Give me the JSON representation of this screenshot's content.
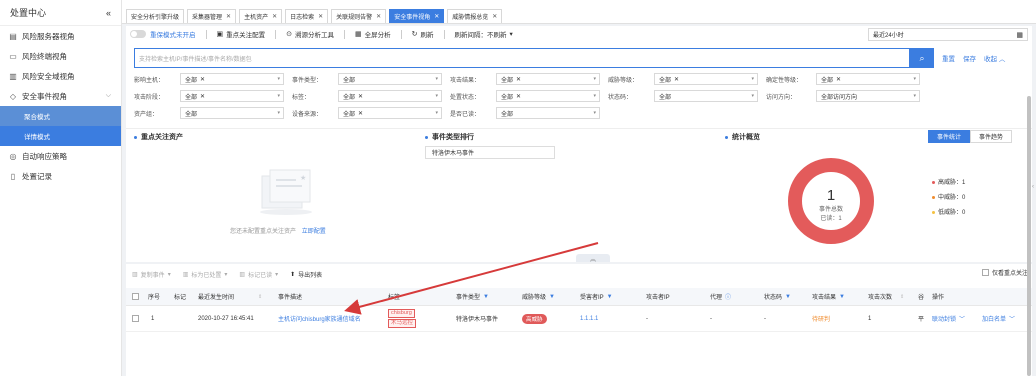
{
  "sidebar": {
    "title": "处置中心",
    "collapse_icon": "«",
    "items": [
      {
        "label": "风险服务器视角",
        "icon": "server-icon"
      },
      {
        "label": "风险终端视角",
        "icon": "monitor-icon"
      },
      {
        "label": "风险安全域视角",
        "icon": "domain-icon"
      },
      {
        "label": "安全事件视角",
        "icon": "shield-icon"
      },
      {
        "label": "自动响应策略",
        "icon": "location-icon"
      },
      {
        "label": "处置记录",
        "icon": "record-icon"
      }
    ],
    "subitems": [
      {
        "label": "聚合模式"
      },
      {
        "label": "详情模式"
      }
    ]
  },
  "tabs": [
    {
      "label": "安全分析引擎升级",
      "closable": false
    },
    {
      "label": "采集器管理",
      "closable": true
    },
    {
      "label": "主机资产",
      "closable": true
    },
    {
      "label": "日志检索",
      "closable": true
    },
    {
      "label": "关联规则告警",
      "closable": true
    },
    {
      "label": "安全事件视角",
      "closable": true,
      "active": true
    },
    {
      "label": "威胁情报总览",
      "closable": true
    }
  ],
  "toolbar": {
    "key_mode": "重保模式未开启",
    "key_config": "重点关注配置",
    "trace_tool": "溯源分析工具",
    "global_analysis": "全屏分析",
    "refresh": "刷新",
    "refresh_interval_label": "刷新间隔：",
    "refresh_interval_value": "不刷新",
    "time_range": "最近24小时"
  },
  "search": {
    "placeholder": "支持检索主机IP/事件描述/事件名称/数据包",
    "reset": "重置",
    "save": "保存",
    "collapse": "收起"
  },
  "filters": {
    "row1": [
      {
        "label": "影响主机：",
        "value": "全部"
      },
      {
        "label": "事件类型：",
        "value": "全部"
      },
      {
        "label": "攻击结果：",
        "value": "全部"
      },
      {
        "label": "威胁等级：",
        "value": "全部"
      },
      {
        "label": "确定性等级：",
        "value": "全部"
      }
    ],
    "row2": [
      {
        "label": "攻击阶段：",
        "value": "全部"
      },
      {
        "label": "标签：",
        "value": "全部"
      },
      {
        "label": "处置状态：",
        "value": "全部"
      },
      {
        "label": "状态码：",
        "value": "全部"
      },
      {
        "label": "访问方向：",
        "value": "全部访问方向"
      }
    ],
    "row3": [
      {
        "label": "资产组：",
        "value": "全部"
      },
      {
        "label": "设备来源：",
        "value": "全部"
      },
      {
        "label": "是否已读：",
        "value": "全部"
      }
    ]
  },
  "sections": {
    "key_assets": "重点关注资产",
    "event_rank": "事件类型排行",
    "stats": "统计概览",
    "empty_text": "您还未配置重点关注资产",
    "empty_link": "立即配置",
    "rank_item": "特洛伊木马事件",
    "stat_btn_events": "事件统计",
    "stat_btn_trend": "事件趋势"
  },
  "chart_data": {
    "type": "pie",
    "center_value": "1",
    "center_label": "事件总数",
    "center_sub": "已读：1",
    "slices": [
      {
        "name": "高威胁",
        "value": 1,
        "color": "#e35b5b"
      },
      {
        "name": "中威胁",
        "value": 0,
        "color": "#f08c2e"
      },
      {
        "name": "低威胁",
        "value": 0,
        "color": "#f5c242"
      }
    ],
    "legend_labels": [
      "高威胁：1",
      "中威胁：0",
      "低威胁：0"
    ]
  },
  "list_toolbar": {
    "copy_event": "复制事件",
    "mark_processed": "标为已处置",
    "mark_read": "标记已读",
    "export": "导出列表",
    "only_key": "仅看重点关注"
  },
  "table": {
    "headers": [
      "序号",
      "标记",
      "最近发生时间",
      "事件描述",
      "标签",
      "事件类型",
      "威胁等级",
      "受害者IP",
      "攻击者IP",
      "代理",
      "状态码",
      "攻击结果",
      "攻击次数",
      "谷",
      "操作"
    ],
    "rows": [
      {
        "index": "1",
        "mark": "",
        "time": "2020-10-27 16:45:41",
        "desc": "主机访问chisburg家族通信域名",
        "tag1": "chisburg",
        "tag2": "木马远控",
        "type": "特洛伊木马事件",
        "threat": "高威胁",
        "victim_ip": "1.1.1.1",
        "attacker_ip": "-",
        "proxy": "-",
        "status": "-",
        "result": "待研判",
        "count": "1",
        "extra": "平",
        "op1": "联动封锁",
        "op2": "加白名单"
      }
    ]
  },
  "colors": {
    "primary": "#3b7de0",
    "danger": "#e35b5b",
    "warning": "#f08c2e",
    "arrow": "#d63a3a"
  }
}
